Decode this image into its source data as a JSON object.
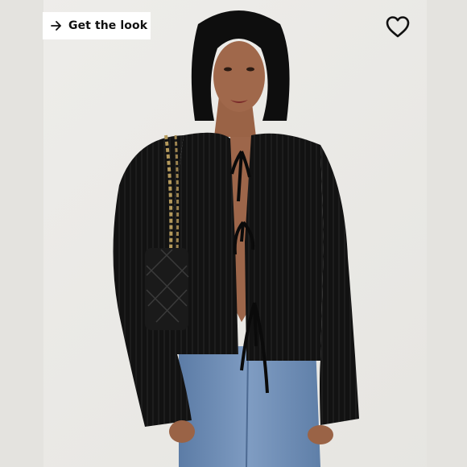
{
  "get_the_look": {
    "label": "Get the look",
    "icon": "arrow-right-icon"
  },
  "favorite": {
    "icon": "heart-icon"
  },
  "photo": {
    "icon": "product-photo"
  },
  "colors": {
    "background": "#e9e8e4",
    "garment": "#111111",
    "denim": "#6f8db3",
    "skin": "#a0684b"
  }
}
